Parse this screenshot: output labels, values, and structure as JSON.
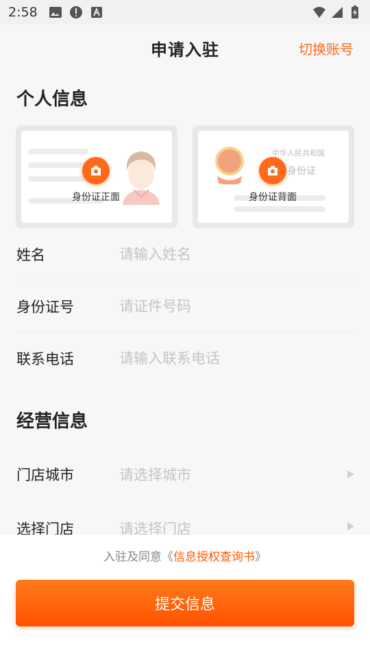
{
  "status_bar": {
    "time": "2:58",
    "left_icons": [
      "image-icon",
      "alert-icon",
      "text-icon"
    ],
    "right_icons": [
      "wifi-icon",
      "signal-icon",
      "battery-icon"
    ]
  },
  "header": {
    "title": "申请入驻",
    "switch_account": "切换账号"
  },
  "personal_section": {
    "title": "个人信息",
    "id_front": {
      "label": "身份证正面"
    },
    "id_back": {
      "label": "身份证背面",
      "emblem_text": "中华人民共和国",
      "emblem_sub": "身份证"
    }
  },
  "personal_fields": [
    {
      "label": "姓名",
      "value": "",
      "placeholder": "请输入姓名"
    },
    {
      "label": "身份证号",
      "value": "",
      "placeholder": "请证件号码"
    },
    {
      "label": "联系电话",
      "value": "",
      "placeholder": "请输入联系电话"
    }
  ],
  "business_section": {
    "title": "经营信息"
  },
  "business_fields": [
    {
      "label": "门店城市",
      "placeholder": "请选择城市"
    },
    {
      "label": "选择门店",
      "placeholder": "请选择门店"
    }
  ],
  "agreement": {
    "prefix": "入驻及同意《",
    "link": "信息授权查询书",
    "suffix": "》"
  },
  "submit_label": "提交信息",
  "colors": {
    "accent": "#ff6a1a",
    "link": "#ff5a00",
    "placeholder": "#c4c4c4",
    "background": "#f7f7f7"
  }
}
